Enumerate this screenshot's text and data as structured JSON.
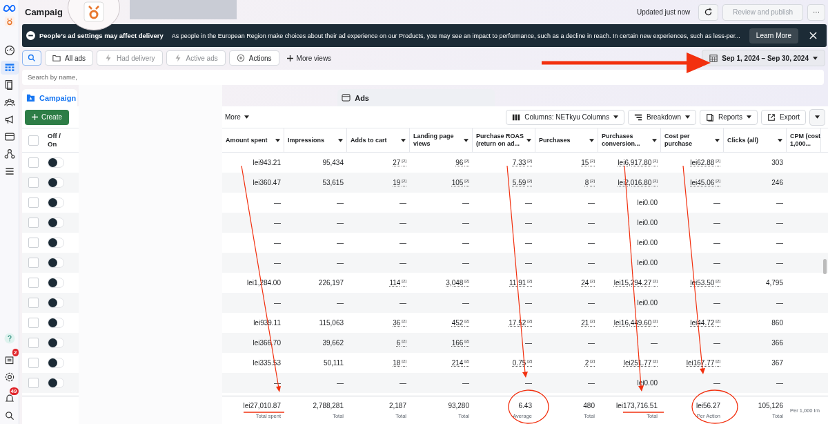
{
  "header": {
    "title": "Campaig",
    "status": "Updated just now",
    "publish_button": {
      "label": "Review and publish",
      "disabled": true
    },
    "more_button": "···"
  },
  "nav": {
    "items": [
      {
        "selected": false
      },
      {
        "selected": true
      },
      {
        "selected": false
      },
      {
        "selected": false
      },
      {
        "selected": false
      },
      {
        "selected": false
      },
      {
        "selected": false
      },
      {
        "selected": false
      }
    ],
    "news_badge": "2",
    "alerts_badge": "49"
  },
  "banner": {
    "title": "People’s ad settings may affect delivery",
    "text": "As people in the European Region make choices about their ad experience on our Products, you may see an impact to performance, such as a decline in reach. In certain new experiences, such as less-per...",
    "button": "Learn More"
  },
  "filters": [
    "All ads",
    "Had delivery",
    "Active ads",
    "Actions"
  ],
  "more_views": "More views",
  "date_range": "Sep 1, 2024 – Sep 30, 2024",
  "search": {
    "placeholder": "Search by name,"
  },
  "tabs": [
    {
      "label": "Campaign",
      "selected": true
    },
    {
      "label": "Ads",
      "selected": false
    }
  ],
  "create_button": "Create",
  "more_menu": "More",
  "table_actions": [
    "Columns: NETkyu Columns",
    "Breakdown",
    "Reports",
    "Export"
  ],
  "table": {
    "select_all_checked": false,
    "toggle_header": "Off / On",
    "columns": [
      "Amount spent",
      "Impressions",
      "Adds to cart",
      "Landing page views",
      "Purchase ROAS (return on ad...",
      "Purchases",
      "Purchases conversion...",
      "Cost per purchase",
      "Clicks (all)",
      "CPM (cost 1,000..."
    ],
    "rows": [
      {
        "checked": false,
        "on": false,
        "cells": [
          "lei943.21",
          "95,434",
          "27$^{[2]}$",
          "96$^{[2]}$",
          "7.33$^{[2]}$",
          "15$^{[2]}$",
          "lei6,917.80$^{[2]}$",
          "lei62.88$^{[2]}$",
          "303"
        ]
      },
      {
        "checked": false,
        "on": false,
        "cells": [
          "lei360.47",
          "53,615",
          "19$^{[2]}$",
          "105$^{[2]}$",
          "5.59$^{[2]}$",
          "8$^{[2]}$",
          "lei2,016.80$^{[2]}$",
          "lei45.06$^{[2]}$",
          "246"
        ]
      },
      {
        "checked": false,
        "on": false,
        "cells": [
          "—",
          "—",
          "—",
          "—",
          "—",
          "—",
          "lei0.00",
          "—",
          "—"
        ]
      },
      {
        "checked": false,
        "on": false,
        "cells": [
          "—",
          "—",
          "—",
          "—",
          "—",
          "—",
          "lei0.00",
          "—",
          "—"
        ]
      },
      {
        "checked": false,
        "on": false,
        "cells": [
          "—",
          "—",
          "—",
          "—",
          "—",
          "—",
          "lei0.00",
          "—",
          "—"
        ]
      },
      {
        "checked": false,
        "on": false,
        "cells": [
          "—",
          "—",
          "—",
          "—",
          "—",
          "—",
          "lei0.00",
          "—",
          "—"
        ]
      },
      {
        "checked": false,
        "on": false,
        "cells": [
          "lei1,284.00",
          "226,197",
          "114$^{[2]}$",
          "3,048$^{[2]}$",
          "11.91$^{[2]}$",
          "24$^{[2]}$",
          "lei15,294.27$^{[2]}$",
          "lei53.50$^{[2]}$",
          "4,795"
        ]
      },
      {
        "checked": false,
        "on": false,
        "cells": [
          "—",
          "—",
          "—",
          "—",
          "—",
          "—",
          "lei0.00",
          "—",
          "—"
        ]
      },
      {
        "checked": false,
        "on": false,
        "cells": [
          "lei939.11",
          "115,063",
          "36$^{[2]}$",
          "452$^{[2]}$",
          "17.52$^{[2]}$",
          "21$^{[2]}$",
          "lei16,449.60$^{[2]}$",
          "lei44.72$^{[2]}$",
          "860"
        ]
      },
      {
        "checked": false,
        "on": false,
        "cells": [
          "lei366.70",
          "39,662",
          "6$^{[2]}$",
          "166$^{[2]}$",
          "—",
          "—",
          "—",
          "—",
          "366"
        ]
      },
      {
        "checked": false,
        "on": false,
        "cells": [
          "lei335.53",
          "50,111",
          "18$^{[2]}$",
          "214$^{[2]}$",
          "0.75$^{[2]}$",
          "2$^{[2]}$",
          "lei251.77$^{[2]}$",
          "lei167.77$^{[2]}$",
          "367"
        ]
      },
      {
        "checked": false,
        "on": false,
        "cells": [
          "—",
          "—",
          "—",
          "—",
          "—",
          "—",
          "lei0.00",
          "—",
          "—"
        ]
      }
    ],
    "totals": [
      {
        "value": "lei27,010.87",
        "label": "Total spent"
      },
      {
        "value": "2,788,281",
        "label": "Total"
      },
      {
        "value": "2,187",
        "label": "Total"
      },
      {
        "value": "93,280",
        "label": "Total"
      },
      {
        "value": "6.43",
        "label": "Average"
      },
      {
        "value": "480",
        "label": "Total"
      },
      {
        "value": "lei173,716.51",
        "label": "Total"
      },
      {
        "value": "lei56.27",
        "label": "Per Action"
      },
      {
        "value": "105,126",
        "label": "Total"
      },
      {
        "label": "Per 1,000 Im"
      }
    ]
  }
}
